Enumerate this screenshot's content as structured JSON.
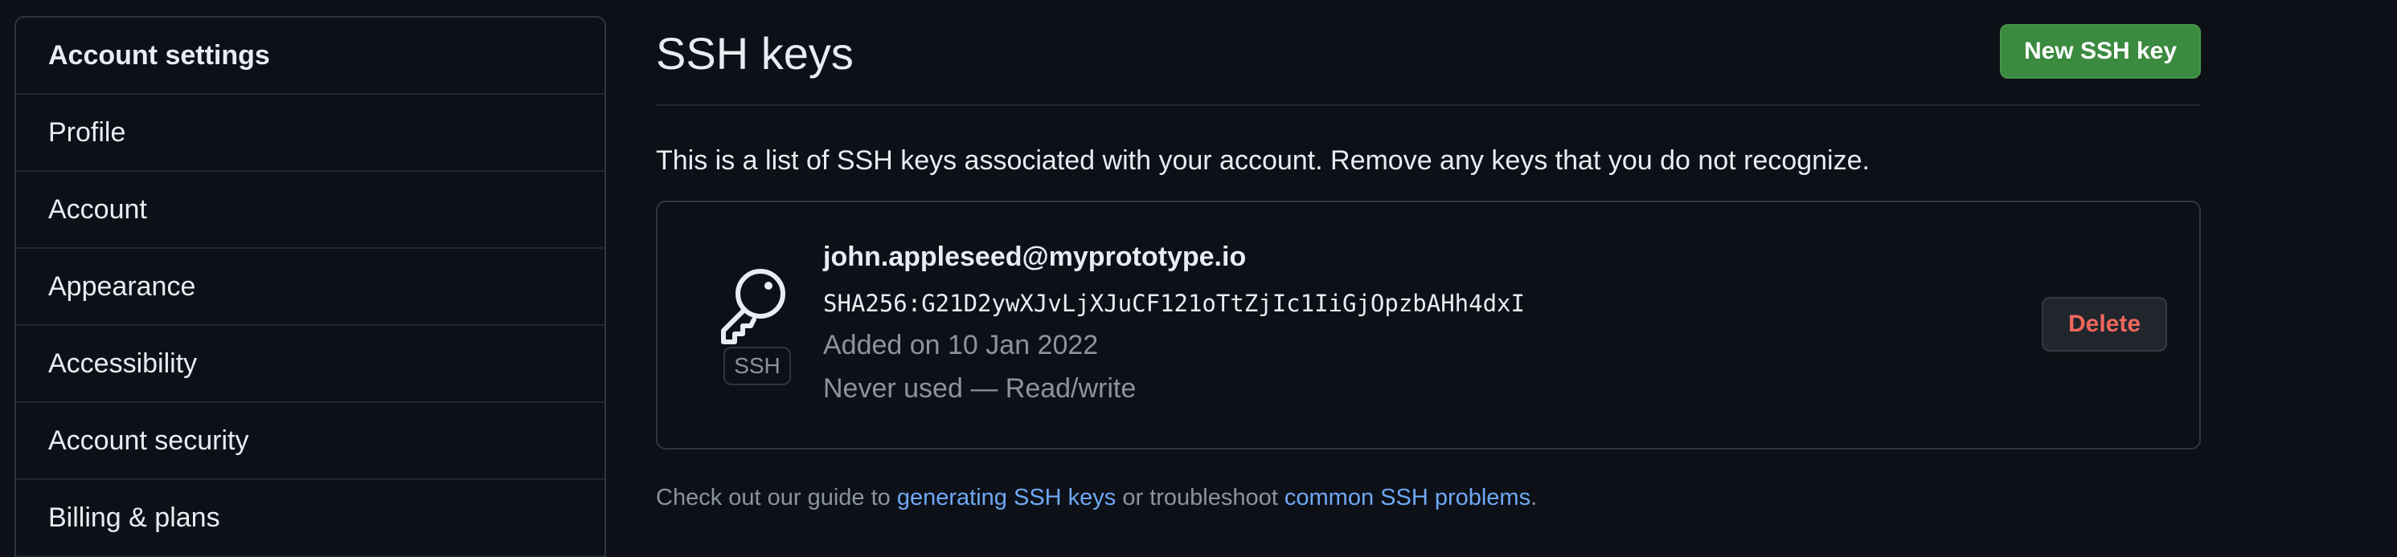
{
  "sidebar": {
    "header": "Account settings",
    "items": [
      {
        "label": "Profile"
      },
      {
        "label": "Account"
      },
      {
        "label": "Appearance"
      },
      {
        "label": "Accessibility"
      },
      {
        "label": "Account security"
      },
      {
        "label": "Billing & plans"
      }
    ]
  },
  "main": {
    "title": "SSH keys",
    "new_key_label": "New SSH key",
    "intro": "This is a list of SSH keys associated with your account. Remove any keys that you do not recognize.",
    "key": {
      "icon": "key-icon",
      "badge": "SSH",
      "title": "john.appleseed@myprototype.io",
      "fingerprint": "SHA256:G21D2ywXJvLjXJuCF121oTtZjIc1IiGjOpzbAHh4dxI",
      "added": "Added on 10 Jan 2022",
      "usage": "Never used — Read/write",
      "delete_label": "Delete"
    },
    "footer": {
      "prefix": "Check out our guide to ",
      "link1": "generating SSH keys",
      "middle": " or troubleshoot ",
      "link2": "common SSH problems",
      "suffix": "."
    }
  },
  "colors": {
    "background": "#0d1117",
    "primary_button": "#3a8a3f",
    "danger_text": "#f0665c",
    "link": "#6fa8f5",
    "muted_text": "#8b949e"
  }
}
